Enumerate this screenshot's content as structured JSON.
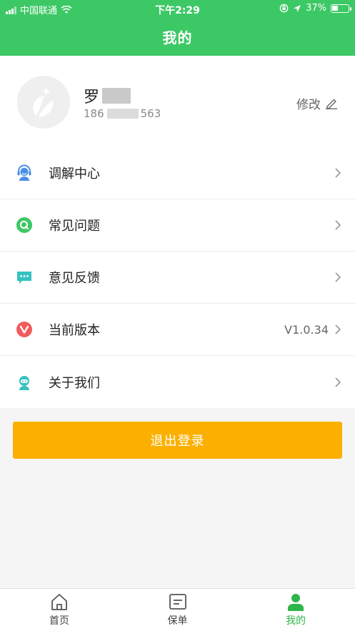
{
  "status_bar": {
    "carrier": "中国联通",
    "time": "下午2:29",
    "battery": "37%",
    "battery_level": 0.37
  },
  "header": {
    "title": "我的"
  },
  "profile": {
    "name_visible": "罗",
    "phone_prefix": "186",
    "phone_suffix": "563",
    "edit_label": "修改"
  },
  "menu": {
    "items": [
      {
        "label": "调解中心",
        "icon": "headset-icon",
        "color": "#4a8fe7"
      },
      {
        "label": "常见问题",
        "icon": "question-icon",
        "color": "#3dc866"
      },
      {
        "label": "意见反馈",
        "icon": "chat-icon",
        "color": "#35c2c0"
      },
      {
        "label": "当前版本",
        "icon": "version-icon",
        "color": "#f25b5b",
        "value": "V1.0.34"
      },
      {
        "label": "关于我们",
        "icon": "about-icon",
        "color": "#35c2c0"
      }
    ]
  },
  "logout": {
    "label": "退出登录",
    "color": "#fbb000"
  },
  "tabbar": {
    "tabs": [
      {
        "label": "首页",
        "icon": "home-icon",
        "active": false
      },
      {
        "label": "保单",
        "icon": "policy-icon",
        "active": false
      },
      {
        "label": "我的",
        "icon": "person-icon",
        "active": true
      }
    ]
  },
  "colors": {
    "brand_green": "#3dc866",
    "tab_active": "#2fb64a"
  }
}
